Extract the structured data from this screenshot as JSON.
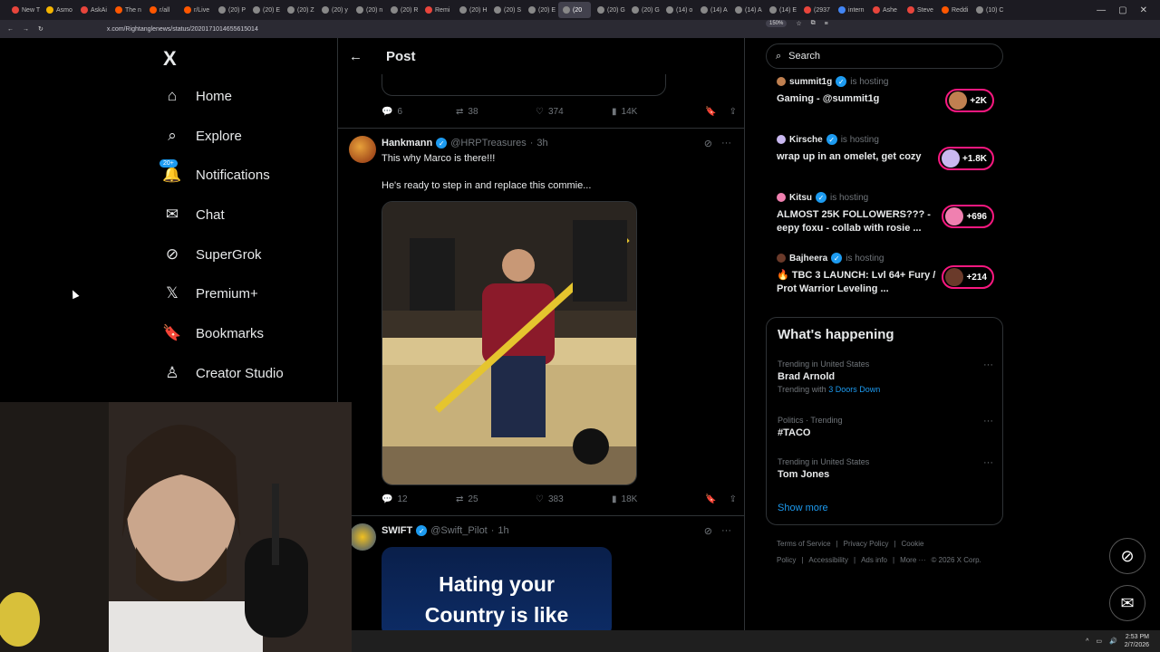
{
  "browser": {
    "tabs": [
      "New T",
      "Asmo",
      "AskAi",
      "The n",
      "r/all",
      "r/Live",
      "(20) P",
      "(20) E",
      "(20) Z",
      "(20) y",
      "(20) n",
      "(20) R",
      "Remi",
      "(20) H",
      "(20) S",
      "(20) E",
      "(20",
      "(20) G",
      "(20) G",
      "(14) o",
      "(14) A",
      "(14) A",
      "(14) E",
      "(2937",
      "intern",
      "Ashe",
      "Steve",
      "Reddi",
      "(10) C"
    ],
    "active_tab_index": 16,
    "url": "x.com/Rightanglenews/status/2020171014655615014",
    "zoom": "150%"
  },
  "nav": {
    "logo": "X",
    "items": [
      {
        "label": "Home",
        "icon": "home-icon",
        "glyph": "⌂"
      },
      {
        "label": "Explore",
        "icon": "search-icon",
        "glyph": "⌕"
      },
      {
        "label": "Notifications",
        "icon": "bell-icon",
        "glyph": "🔔",
        "badge": "20+"
      },
      {
        "label": "Chat",
        "icon": "mail-icon",
        "glyph": "✉"
      },
      {
        "label": "SuperGrok",
        "icon": "grok-icon",
        "glyph": "⊘"
      },
      {
        "label": "Premium+",
        "icon": "x-logo-icon",
        "glyph": "𝕏"
      },
      {
        "label": "Bookmarks",
        "icon": "bookmark-icon",
        "glyph": "🔖"
      },
      {
        "label": "Creator Studio",
        "icon": "creator-icon",
        "glyph": "♙"
      }
    ]
  },
  "feed": {
    "header_title": "Post",
    "prev_actions": {
      "replies": "6",
      "reposts": "38",
      "likes": "374",
      "views": "14K"
    },
    "posts": [
      {
        "name": "Hankmann",
        "handle": "@HRPTreasures",
        "time": "3h",
        "text_1": "This why Marco is there!!!",
        "text_2": "He's ready to step in and replace this commie...",
        "actions": {
          "replies": "12",
          "reposts": "25",
          "likes": "383",
          "views": "18K"
        }
      },
      {
        "name": "SWIFT",
        "handle": "@Swift_Pilot",
        "time": "1h",
        "media_text_1": "Hating your",
        "media_text_2": "Country is like"
      }
    ]
  },
  "sidebar": {
    "search_placeholder": "Search",
    "spaces": [
      {
        "host": "summit1g",
        "is_hosting": "is hosting",
        "title": "Gaming - @summit1g",
        "count": "+2K"
      },
      {
        "host": "Kirsche",
        "is_hosting": "is hosting",
        "title": "wrap up in an omelet, get cozy",
        "count": "+1.8K"
      },
      {
        "host": "Kitsu",
        "is_hosting": "is hosting",
        "title": "ALMOST 25K FOLLOWERS??? - eepy foxu - collab with rosie ...",
        "count": "+696"
      },
      {
        "host": "Bajheera",
        "is_hosting": "is hosting",
        "title": "🔥 TBC 3 LAUNCH: Lvl 64+ Fury / Prot Warrior Leveling ...",
        "count": "+214"
      }
    ],
    "whats_happening": {
      "title": "What's happening",
      "trends": [
        {
          "context": "Trending in United States",
          "name": "Brad Arnold",
          "with_label": "Trending with",
          "with_link": "3 Doors Down"
        },
        {
          "context": "Politics · Trending",
          "name": "#TACO"
        },
        {
          "context": "Trending in United States",
          "name": "Tom Jones"
        }
      ],
      "show_more": "Show more"
    },
    "footer": [
      "Terms of Service",
      "|",
      "Privacy Policy",
      "|",
      "Cookie Policy",
      "|",
      "Accessibility",
      "|",
      "Ads info",
      "|",
      "More ···",
      "© 2026 X Corp."
    ]
  },
  "taskbar": {
    "time": "2:53 PM",
    "date": "2/7/2026"
  }
}
